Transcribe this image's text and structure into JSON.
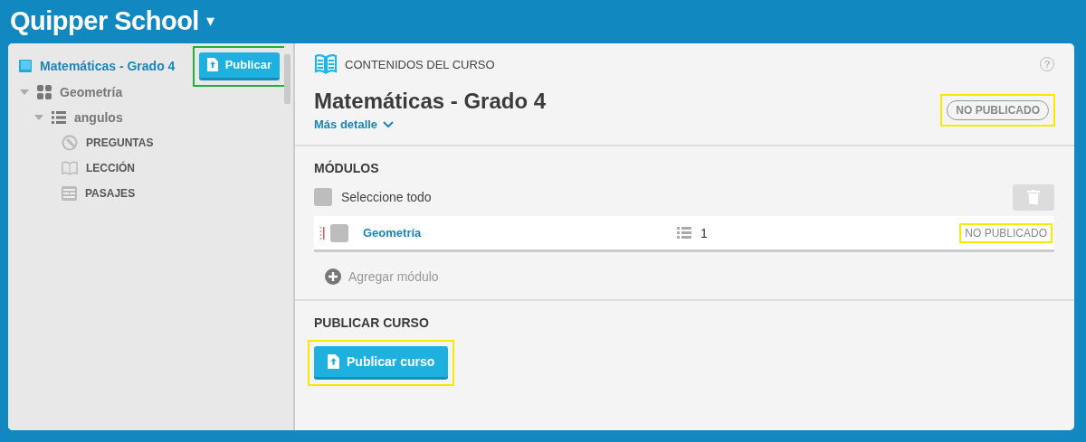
{
  "header": {
    "title": "Quipper School",
    "caret": "▾"
  },
  "sidebar": {
    "course": {
      "title": "Matemáticas - Grado 4"
    },
    "publish_button": {
      "label": "Publicar",
      "highlight": {
        "color": "#1fb03a"
      }
    },
    "tree": [
      {
        "label": "Geometría",
        "kind": "module",
        "expanded": true,
        "children": [
          {
            "label": "angulos",
            "kind": "topic",
            "expanded": true,
            "children": [
              {
                "label": "PREGUNTAS",
                "kind": "questions"
              },
              {
                "label": "LECCIÓN",
                "kind": "lesson"
              },
              {
                "label": "PASAJES",
                "kind": "passages"
              }
            ]
          }
        ]
      }
    ]
  },
  "content": {
    "section_title": "CONTENIDOS DEL CURSO",
    "help": "?",
    "course_title": "Matemáticas - Grado 4",
    "more_link": "Más detalle",
    "status_badge": {
      "label": "NO PUBLICADO",
      "highlight": {
        "color": "#f5ea00"
      }
    },
    "modules": {
      "heading": "MÓDULOS",
      "select_all": {
        "label": "Seleccione todo",
        "checked": false
      },
      "rows": [
        {
          "name": "Geometría",
          "checked": false,
          "count": "1",
          "status": {
            "label": "NO PUBLICADO",
            "highlight": {
              "color": "#f5ea00"
            }
          }
        }
      ],
      "add": "Agregar módulo"
    },
    "publish": {
      "heading": "PUBLICAR CURSO",
      "button": {
        "label": "Publicar curso",
        "highlight": {
          "color": "#f5ea00"
        }
      }
    }
  }
}
